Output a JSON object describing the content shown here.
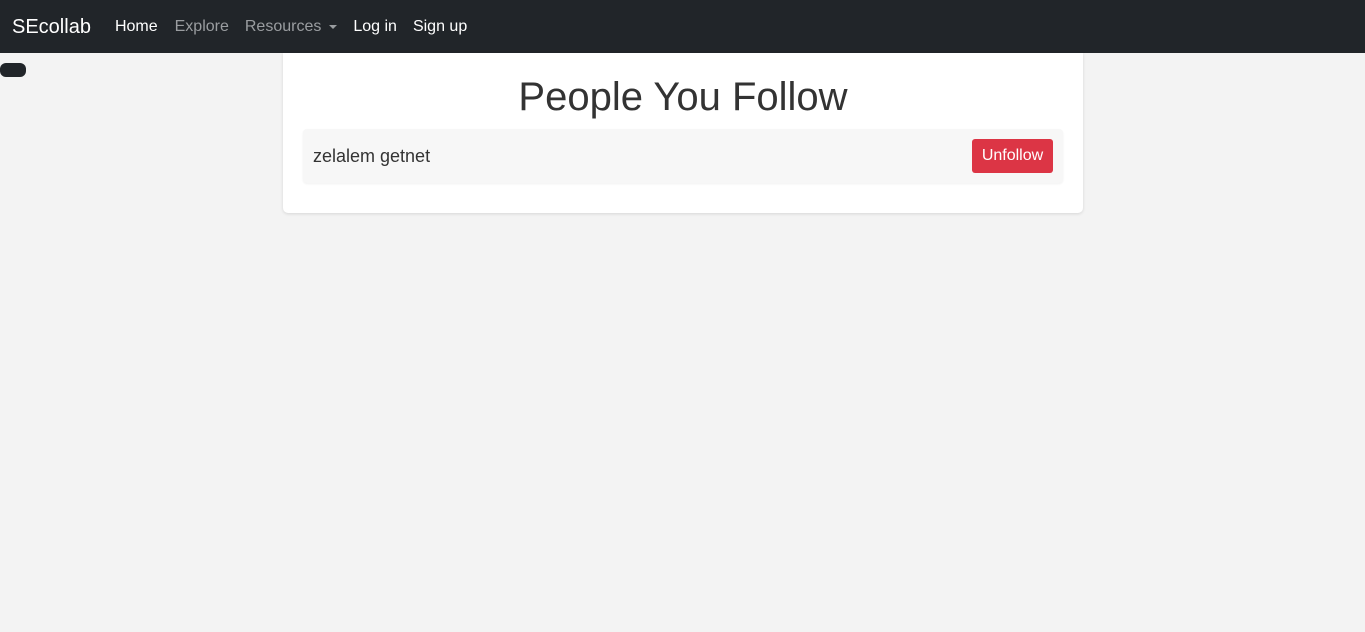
{
  "navbar": {
    "brand": "SEcollab",
    "items": [
      {
        "label": "Home"
      },
      {
        "label": "Explore"
      },
      {
        "label": "Resources"
      },
      {
        "label": "Log in"
      },
      {
        "label": "Sign up"
      }
    ]
  },
  "page": {
    "title": "People You Follow",
    "following": [
      {
        "name": "zelalem getnet",
        "action_label": "Unfollow"
      }
    ]
  },
  "colors": {
    "navbar_bg": "#212529",
    "page_bg": "#f3f3f3",
    "danger": "#dc3545"
  }
}
